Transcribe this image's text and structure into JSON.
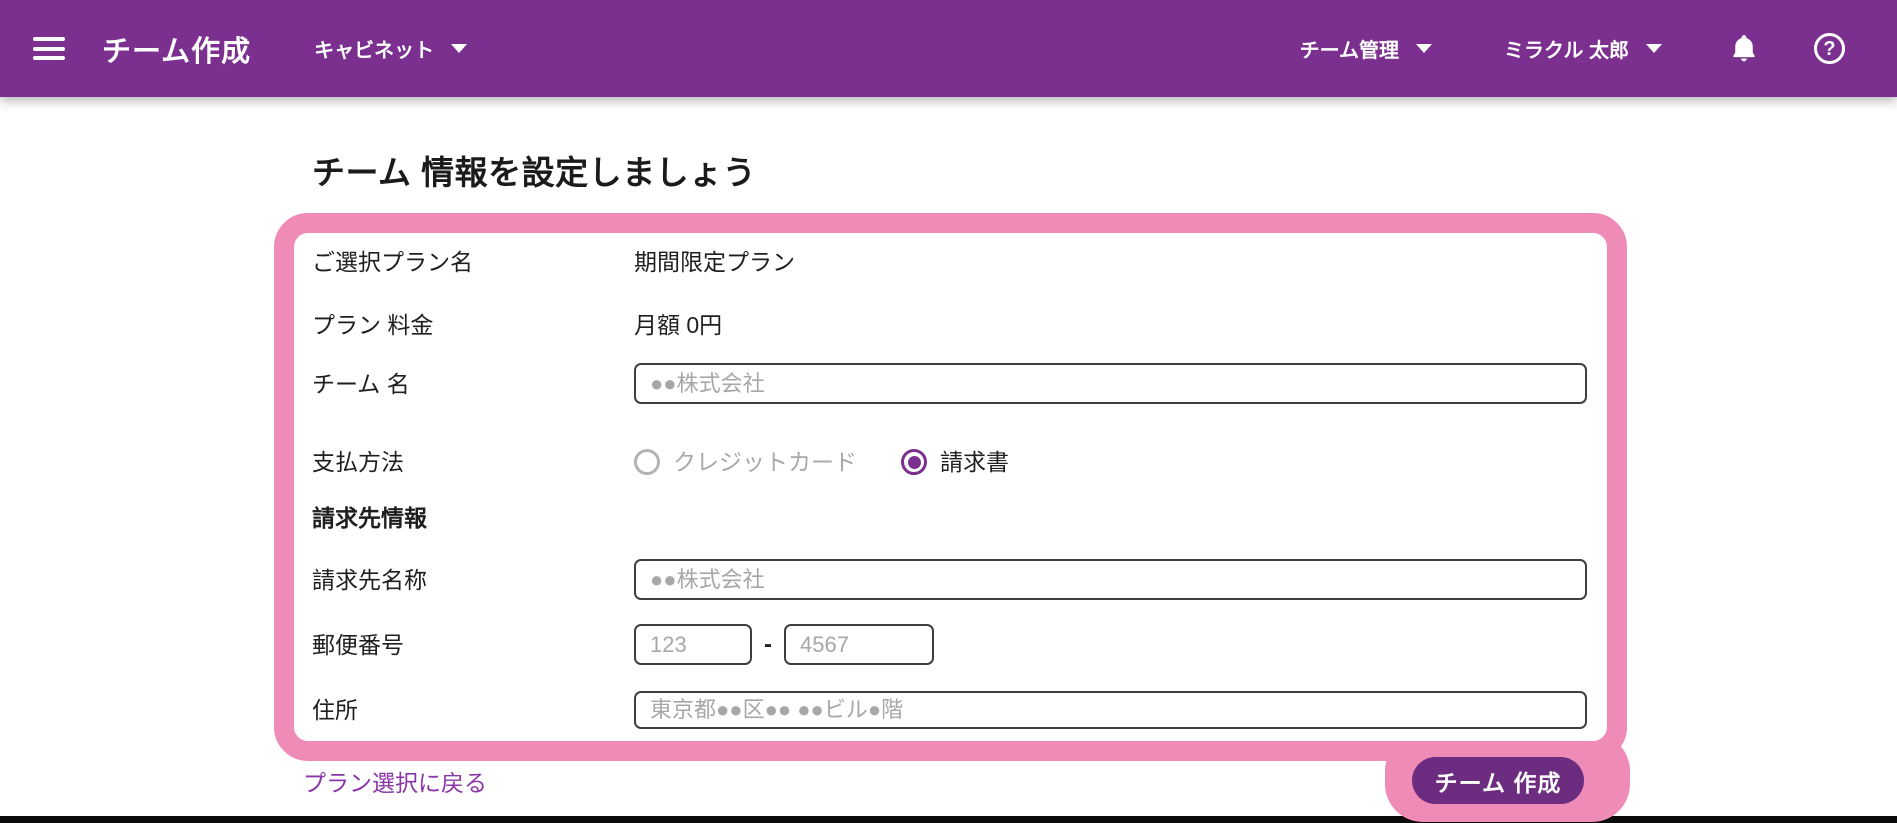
{
  "header": {
    "app_title": "チーム作成",
    "cabinet_label": "キャビネット",
    "team_management_label": "チーム管理",
    "user_name": "ミラクル 太郎"
  },
  "main": {
    "heading": "チーム 情報を設定しましょう",
    "form": {
      "plan_name": {
        "label": "ご選択プラン名",
        "value": "期間限定プラン"
      },
      "plan_fee": {
        "label": "プラン 料金",
        "value": "月額 0円"
      },
      "team_name": {
        "label": "チーム 名",
        "placeholder": "●●株式会社"
      },
      "payment_method": {
        "label": "支払方法",
        "credit_card_label": "クレジットカード",
        "invoice_label": "請求書",
        "selected_option": "請求書"
      },
      "billing_section_title": "請求先情報",
      "billing_name": {
        "label": "請求先名称",
        "placeholder": "●●株式会社"
      },
      "postal_code": {
        "label": "郵便番号",
        "placeholder_first": "123",
        "placeholder_second": "4567",
        "separator": "-"
      },
      "address": {
        "label": "住所",
        "placeholder": "東京都●●区●● ●●ビル●階"
      }
    },
    "back_link": "プラン選択に戻る",
    "submit_button": "チーム 作成"
  },
  "icons": {
    "hamburger": "menu-icon",
    "bell": "notifications-icon",
    "help": "help-icon",
    "caret": "chevron-down-icon"
  },
  "colors": {
    "header_purple": "#7B3090",
    "highlight_pink": "#EF8BB7",
    "button_purple": "#6C2C80",
    "link_purple": "#8A35A8"
  }
}
